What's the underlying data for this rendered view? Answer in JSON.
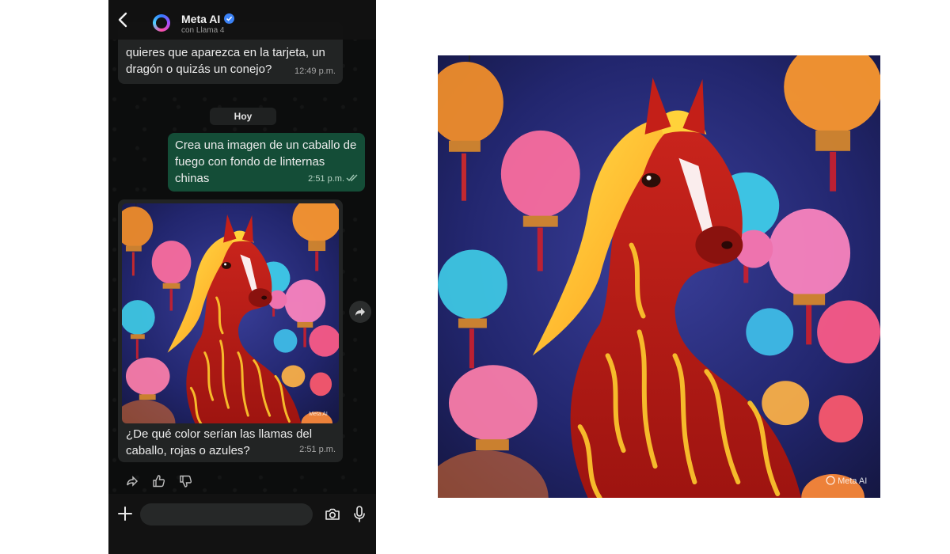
{
  "header": {
    "contact_name": "Meta AI",
    "subtitle": "con Llama 4"
  },
  "messages": [
    {
      "direction": "incoming",
      "text": "quieres que aparezca en la tarjeta, un dragón o quizás un conejo?",
      "time": "12:49 p.m."
    },
    {
      "direction": "outgoing",
      "text": "Crea una imagen de un caballo de fuego con fondo de linternas chinas",
      "time": "2:51 p.m.",
      "status": "read"
    },
    {
      "direction": "incoming",
      "has_image": true,
      "text": "¿De qué color serían las llamas del caballo, rojas o azules?",
      "time": "2:51 p.m."
    }
  ],
  "day_separator": "Hoy",
  "image": {
    "description_icon": "fire-horse-lanterns-image",
    "watermark": "Meta AI"
  },
  "colors": {
    "outgoing_bubble": "#144d37",
    "incoming_bubble": "#222424",
    "verified": "#3b82f6",
    "background_dark": "#0c0d0d"
  }
}
